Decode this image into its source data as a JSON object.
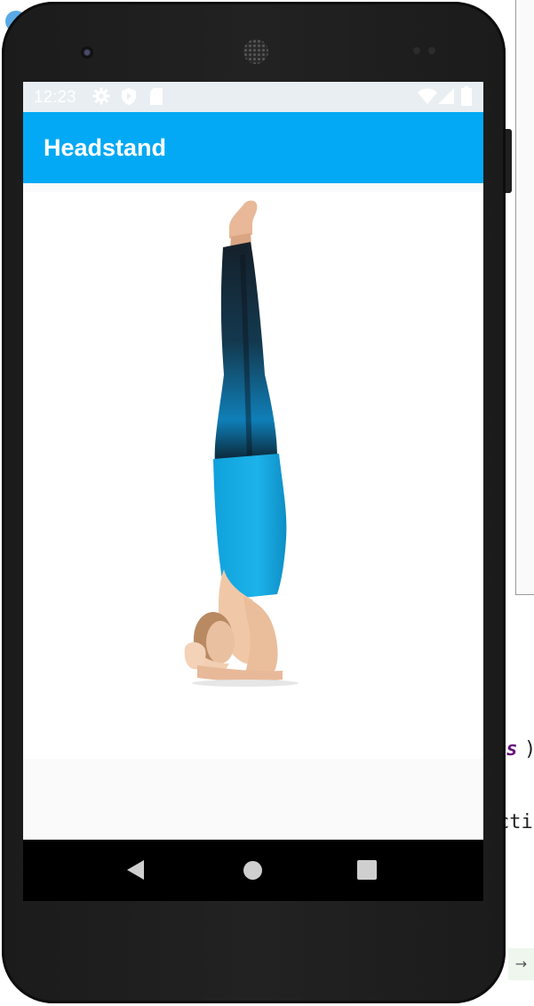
{
  "app": {
    "title": "Headstand"
  },
  "status_bar": {
    "time": "12:23",
    "left_icons": [
      "gear-icon",
      "shield-icon",
      "sd-card-icon"
    ],
    "right_icons": [
      "wifi-icon",
      "signal-icon",
      "battery-icon"
    ]
  },
  "content": {
    "image_subject": "headstand-pose-photo"
  },
  "nav_bar": {
    "buttons": [
      "back-triangle-icon",
      "home-circle-icon",
      "recents-square-icon"
    ]
  },
  "ide_background": {
    "code_fragment_1_kw": "es",
    "code_fragment_1_tail": ")",
    "code_fragment_2": "cti",
    "arrow": "→"
  },
  "colors": {
    "appbar": "#03a9f4",
    "status_bar": "#e8eef2",
    "nav_bar": "#000000",
    "phone_body": "#1e1e1e",
    "leggings_top": "#0e9ad6",
    "tank_top": "#14a7df"
  }
}
